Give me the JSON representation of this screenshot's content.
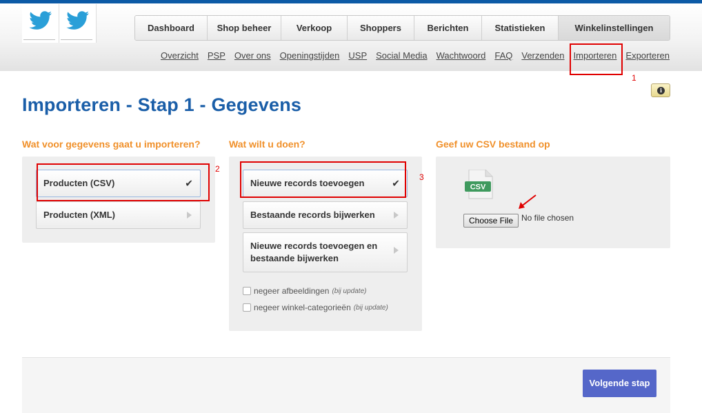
{
  "brand": {
    "accent": "#0c5aa6",
    "title_color": "#1a5ea8",
    "section_color": "#f0902a",
    "button_color": "#5567c9"
  },
  "logos": [
    {
      "icon": "twitter-bird-icon"
    },
    {
      "icon": "twitter-bird-icon"
    }
  ],
  "main_nav": [
    {
      "label": "Dashboard",
      "active": false
    },
    {
      "label": "Shop beheer",
      "active": false
    },
    {
      "label": "Verkoop",
      "active": false
    },
    {
      "label": "Shoppers",
      "active": false
    },
    {
      "label": "Berichten",
      "active": false
    },
    {
      "label": "Statistieken",
      "active": false
    },
    {
      "label": "Winkelinstellingen",
      "active": true
    }
  ],
  "sub_nav": [
    "Overzicht",
    "PSP",
    "Over ons",
    "Openingstijden",
    "USP",
    "Social Media",
    "Wachtwoord",
    "FAQ",
    "Verzenden",
    "Importeren",
    "Exporteren"
  ],
  "annotations": [
    "1",
    "2",
    "3"
  ],
  "page_title": "Importeren - Stap 1 - Gegevens",
  "columns": {
    "type": {
      "title": "Wat voor gegevens gaat u importeren?",
      "options": [
        {
          "label": "Producten (CSV)",
          "selected": true
        },
        {
          "label": "Producten (XML)",
          "selected": false
        }
      ]
    },
    "action": {
      "title": "Wat wilt u doen?",
      "options": [
        {
          "label": "Nieuwe records toevoegen",
          "selected": true
        },
        {
          "label": "Bestaande records bijwerken",
          "selected": false
        },
        {
          "label": "Nieuwe records toevoegen en bestaande bijwerken",
          "selected": false
        }
      ],
      "checkboxes": [
        {
          "label": "negeer afbeeldingen",
          "note": "(bij update)",
          "checked": false
        },
        {
          "label": "negeer winkel-categorieën",
          "note": "(bij update)",
          "checked": false
        }
      ]
    },
    "upload": {
      "title": "Geef uw CSV bestand op",
      "icon_label": "CSV",
      "button_label": "Choose File",
      "status": "No file chosen"
    }
  },
  "footer": {
    "next_label": "Volgende stap"
  }
}
